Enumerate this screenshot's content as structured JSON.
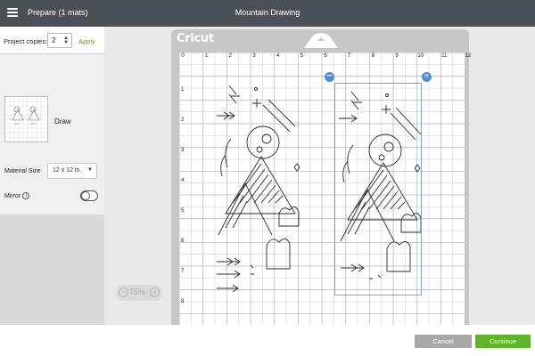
{
  "header": {
    "prepare_title": "Prepare (1 mats)",
    "page_title": "Mountain Drawing"
  },
  "left_panel": {
    "copies_label": "Project copies:",
    "copies_value": "2",
    "apply_label": "Apply",
    "mat_item_label": "Draw",
    "material_size_label": "Material Size",
    "material_size_value": "12 x 12 in.",
    "mirror_label": "Mirror",
    "mirror_on": false
  },
  "canvas": {
    "brand": "Cricut",
    "ruler_top": [
      "0",
      "1",
      "2",
      "3",
      "4",
      "5",
      "6",
      "7",
      "8",
      "9",
      "10",
      "11",
      "12"
    ],
    "ruler_left": [
      "1",
      "2",
      "3",
      "4",
      "5",
      "6",
      "7",
      "8"
    ],
    "zoom_value": "75%",
    "selection_more_icon": "more-icon",
    "selection_rotate_icon": "rotate-icon"
  },
  "footer": {
    "cancel_label": "Cancel",
    "continue_label": "Continue"
  },
  "colors": {
    "header_bg": "#4a5156",
    "apply_green": "#5aa51b",
    "continue_green": "#5eb42b",
    "cancel_gray": "#a8a8a8",
    "selection_blue": "#4f8ed0"
  }
}
